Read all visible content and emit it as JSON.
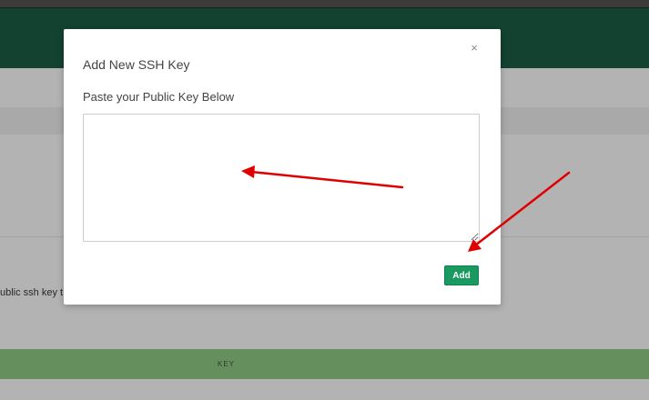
{
  "background": {
    "partial_text": "ublic ssh key t",
    "table_column_key": "KEY"
  },
  "modal": {
    "title": "Add New SSH Key",
    "close_glyph": "×",
    "label": "Paste your Public Key Below",
    "textarea_value": "",
    "add_label": "Add"
  },
  "colors": {
    "header_green": "#134330",
    "table_head_green": "#658f5c",
    "add_button_green": "#1a9a60",
    "arrow_red": "#e00000"
  },
  "icons": {
    "close": "close-icon",
    "resize": "resize-handle-icon"
  }
}
